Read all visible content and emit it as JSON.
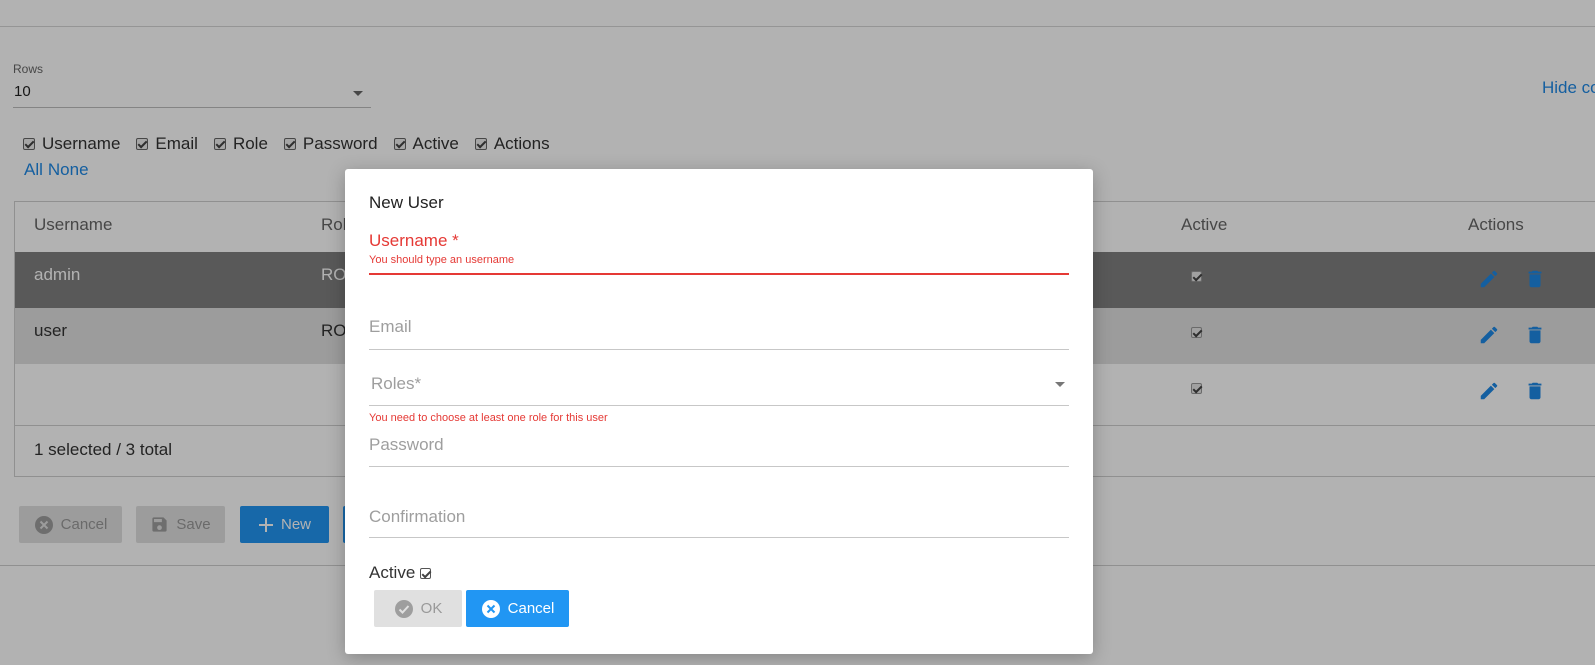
{
  "rows": {
    "label": "Rows",
    "value": "10"
  },
  "hide_link": "Hide co",
  "columns": {
    "toggles": [
      "Username",
      "Email",
      "Role",
      "Password",
      "Active",
      "Actions"
    ],
    "all_label": "All",
    "none_label": "None"
  },
  "table": {
    "headers": {
      "username": "Username",
      "role": "Rol",
      "active": "Active",
      "actions": "Actions"
    },
    "rows": [
      {
        "username": "admin",
        "role": "RO",
        "active": true,
        "selected": true
      },
      {
        "username": "user",
        "role": "RO",
        "active": true,
        "selected": false
      },
      {
        "username": "",
        "role": "",
        "active": true,
        "selected": false
      }
    ],
    "footer": "1 selected / 3 total"
  },
  "toolbar": {
    "cancel_label": "Cancel",
    "save_label": "Save",
    "new_label": "New"
  },
  "dialog": {
    "title": "New User",
    "username_label": "Username *",
    "username_error": "You should type an username",
    "email_label": "Email",
    "roles_label": "Roles*",
    "roles_error": "You need to choose at least one role for this user",
    "password_label": "Password",
    "confirmation_label": "Confirmation",
    "active_label": "Active",
    "active_checked": true,
    "ok_label": "OK",
    "cancel_label": "Cancel"
  },
  "colors": {
    "accent": "#2196f3",
    "link": "#1e88e5",
    "error": "#e53935",
    "selected_row": "#808080"
  }
}
